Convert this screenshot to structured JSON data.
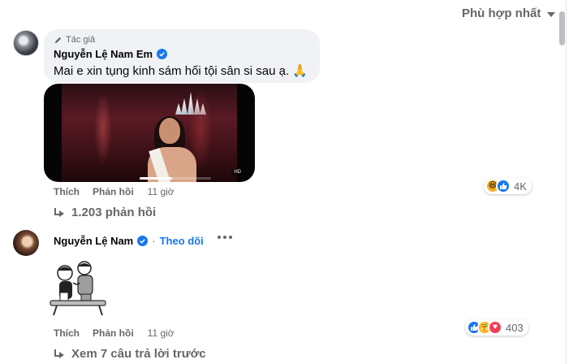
{
  "sort": {
    "label": "Phù hợp nhất"
  },
  "comments": [
    {
      "author_tag": "Tác giả",
      "author": "Nguyễn Lệ Nam Em",
      "text": "Mai e xin tụng kinh sám hối tội sân si sau ạ. 🙏",
      "video_badge": "HD",
      "video_progress": 0.45,
      "actions": {
        "like": "Thích",
        "reply": "Phản hồi",
        "time": "11 giờ"
      },
      "reaction_icons": [
        "haha-icon",
        "like-icon"
      ],
      "reaction_count": "4K",
      "replies_label": "1.203 phản hồi"
    },
    {
      "author": "Nguyễn Lệ Nam",
      "follow": "Theo dõi",
      "actions": {
        "like": "Thích",
        "reply": "Phản hồi",
        "time": "11 giờ"
      },
      "reaction_icons": [
        "like-icon",
        "care-icon",
        "love-icon"
      ],
      "reaction_count": "403",
      "replies_label": "Xem 7 câu trả lời trước"
    }
  ],
  "colors": {
    "link": "#1877f2",
    "secondary_text": "#65676b",
    "bubble": "#f0f2f5"
  }
}
